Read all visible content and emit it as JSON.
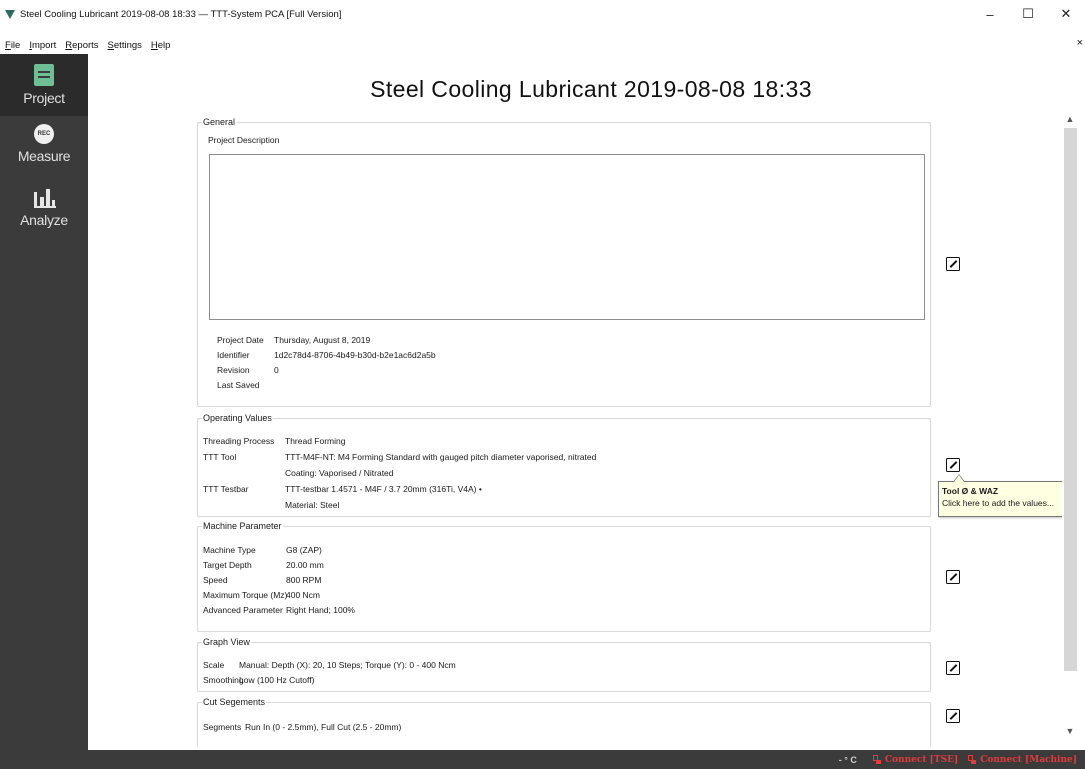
{
  "window": {
    "title": "Steel Cooling Lubricant 2019-08-08 18:33 — TTT-System PCA [Full Version]",
    "minimize": "–",
    "maximize": "☐",
    "close": "✕"
  },
  "menu": {
    "items": [
      "File",
      "Import",
      "Reports",
      "Settings",
      "Help"
    ],
    "close": "×"
  },
  "sidebar": {
    "items": [
      {
        "label": "Project",
        "icon": "project-icon",
        "active": true
      },
      {
        "label": "Measure",
        "icon": "rec-icon",
        "icon_text": "REC"
      },
      {
        "label": "Analyze",
        "icon": "analyze-icon"
      }
    ]
  },
  "page": {
    "title": "Steel Cooling Lubricant 2019-08-08 18:33"
  },
  "general": {
    "legend": "General",
    "desc_label": "Project Description",
    "description": "",
    "fields": [
      {
        "label": "Project Date",
        "value": "Thursday, August 8, 2019"
      },
      {
        "label": "Identifier",
        "value": "1d2c78d4-8706-4b49-b30d-b2e1ac6d2a5b"
      },
      {
        "label": "Revision",
        "value": "0"
      },
      {
        "label": "Last Saved",
        "value": ""
      }
    ]
  },
  "operating": {
    "legend": "Operating Values",
    "fields": [
      {
        "label": "Threading Process",
        "value": "Thread Forming"
      },
      {
        "label": "TTT Tool",
        "value": "TTT-M4F-NT: M4 Forming Standard with gauged pitch diameter vaporised, nitrated"
      },
      {
        "label": "",
        "value": "Coating: Vaporised / Nitrated"
      },
      {
        "label": "TTT Testbar",
        "value": "TTT-testbar 1.4571 - M4F / 3.7 20mm (316Ti, V4A) •"
      },
      {
        "label": "",
        "value": "Material: Steel"
      }
    ]
  },
  "machine": {
    "legend": "Machine Parameter",
    "fields": [
      {
        "label": "Machine Type",
        "value": "G8 (ZAP)"
      },
      {
        "label": "Target Depth",
        "value": "20.00 mm"
      },
      {
        "label": "Speed",
        "value": "800 RPM"
      },
      {
        "label": "Maximum Torque (Mz)",
        "value": "400 Ncm"
      },
      {
        "label": "Advanced Parameter",
        "value": "Right Hand; 100%"
      }
    ]
  },
  "graph": {
    "legend": "Graph View",
    "fields": [
      {
        "label": "Scale",
        "value": "Manual: Depth (X): 20, 10 Steps; Torque (Y): 0 - 400 Ncm"
      },
      {
        "label": "Smoothing",
        "value": "Low (100 Hz Cutoff)"
      }
    ]
  },
  "cuts": {
    "legend": "Cut Segements",
    "fields": [
      {
        "label": "Segments",
        "value": "Run In (0 - 2.5mm), Full Cut (2.5 - 20mm)"
      }
    ]
  },
  "tooltip": {
    "title": "Tool Ø & WAZ",
    "body": "Click here to add the values..."
  },
  "status": {
    "temperature": "- ° C",
    "connect_tse": "Connect [TSE]",
    "connect_machine": "Connect [Machine]"
  },
  "colors": {
    "sidebar": "#3b3b3b",
    "accent_green": "#6fbf95",
    "status_red": "#e23b3b",
    "tooltip_bg": "#ffffe1"
  }
}
